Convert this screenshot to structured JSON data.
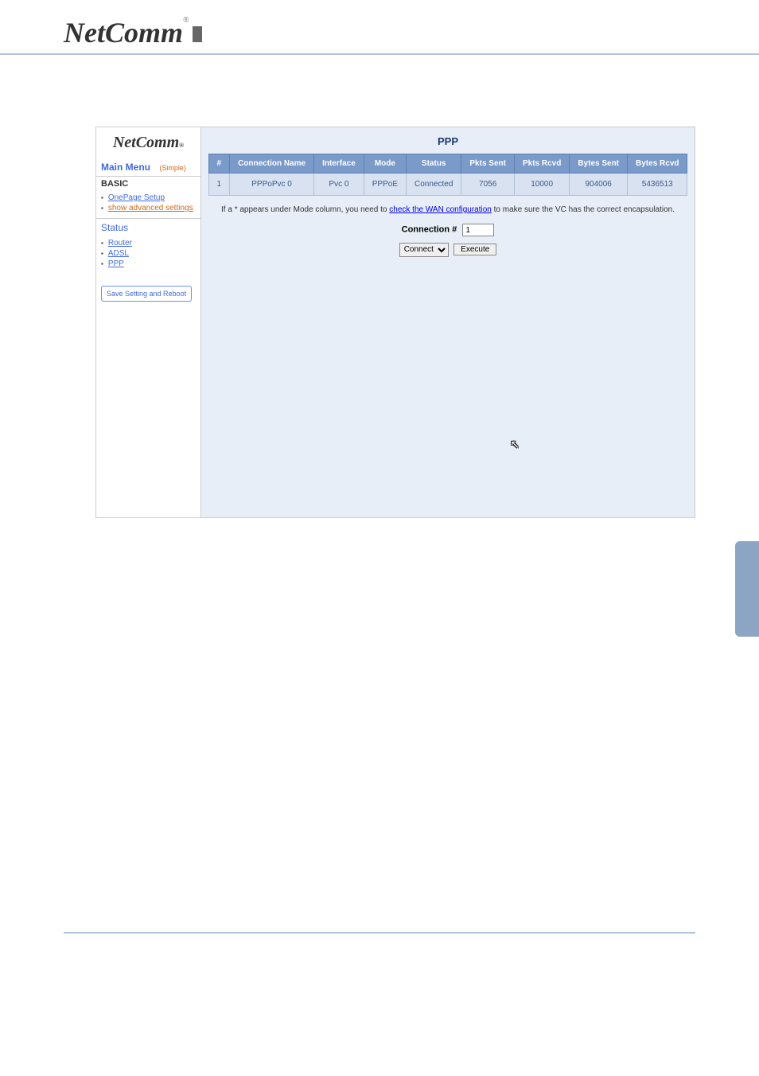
{
  "page_title": "PPP",
  "sidebar": {
    "main_menu_label": "Main Menu",
    "main_menu_mode": "(Simple)",
    "basic_label": "BASIC",
    "basic_items": [
      {
        "label": "OnePage Setup"
      },
      {
        "label": "show advanced settings"
      }
    ],
    "status_label": "Status",
    "status_items": [
      {
        "label": "Router"
      },
      {
        "label": "ADSL"
      },
      {
        "label": "PPP"
      }
    ],
    "save_button_label": "Save Setting and Reboot"
  },
  "table": {
    "headers": [
      "#",
      "Connection Name",
      "Interface",
      "Mode",
      "Status",
      "Pkts Sent",
      "Pkts Rcvd",
      "Bytes Sent",
      "Bytes Rcvd"
    ],
    "rows": [
      {
        "num": "1",
        "connection_name": "PPPoPvc 0",
        "interface": "Pvc 0",
        "mode": "PPPoE",
        "status": "Connected",
        "pkts_sent": "7056",
        "pkts_rcvd": "10000",
        "bytes_sent": "904006",
        "bytes_rcvd": "5436513"
      }
    ]
  },
  "note": {
    "prefix": "If a * appears under Mode column, you need to ",
    "link": "check the WAN configuration",
    "suffix": " to make sure the VC has the correct encapsulation."
  },
  "connection": {
    "label": "Connection #",
    "value": "1"
  },
  "action": {
    "select_value": "Connect",
    "button_label": "Execute"
  }
}
